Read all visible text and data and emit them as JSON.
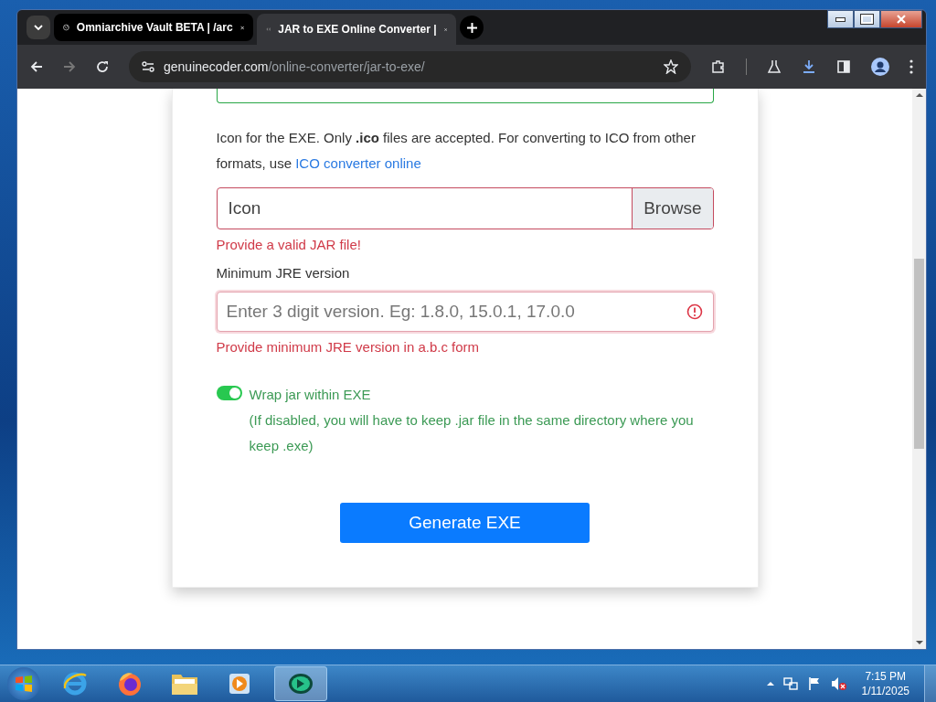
{
  "browser": {
    "tabs": [
      {
        "title": "Omniarchive Vault BETA | /arc",
        "selected": false,
        "kind": "globe"
      },
      {
        "title": "JAR to EXE Online Converter |",
        "selected": true,
        "kind": "site"
      }
    ],
    "address": {
      "domain": "genuinecoder.com",
      "path": "/online-converter/jar-to-exe/"
    }
  },
  "form": {
    "url_field": {
      "valid": true
    },
    "icon_help": "Icon for the EXE. Only **.ico** files are accepted. For converting to ICO from other formats, use ",
    "icon_help_link": "ICO converter online",
    "icon_field": {
      "label": "Icon",
      "button": "Browse",
      "invalid": true,
      "error": "Provide a valid JAR file!"
    },
    "jre": {
      "label": "Minimum JRE version",
      "placeholder": "Enter 3 digit version. Eg: 1.8.0, 15.0.1, 17.0.0",
      "invalid": true,
      "error": "Provide minimum JRE version in a.b.c form"
    },
    "wrap": {
      "on": true,
      "label": "Wrap jar within EXE",
      "note": "(If disabled, you will have to keep .jar file in the same directory where you keep .exe)"
    },
    "submit": "Generate EXE"
  },
  "taskbar": {
    "time": "7:15 PM",
    "date": "1/11/2025"
  }
}
